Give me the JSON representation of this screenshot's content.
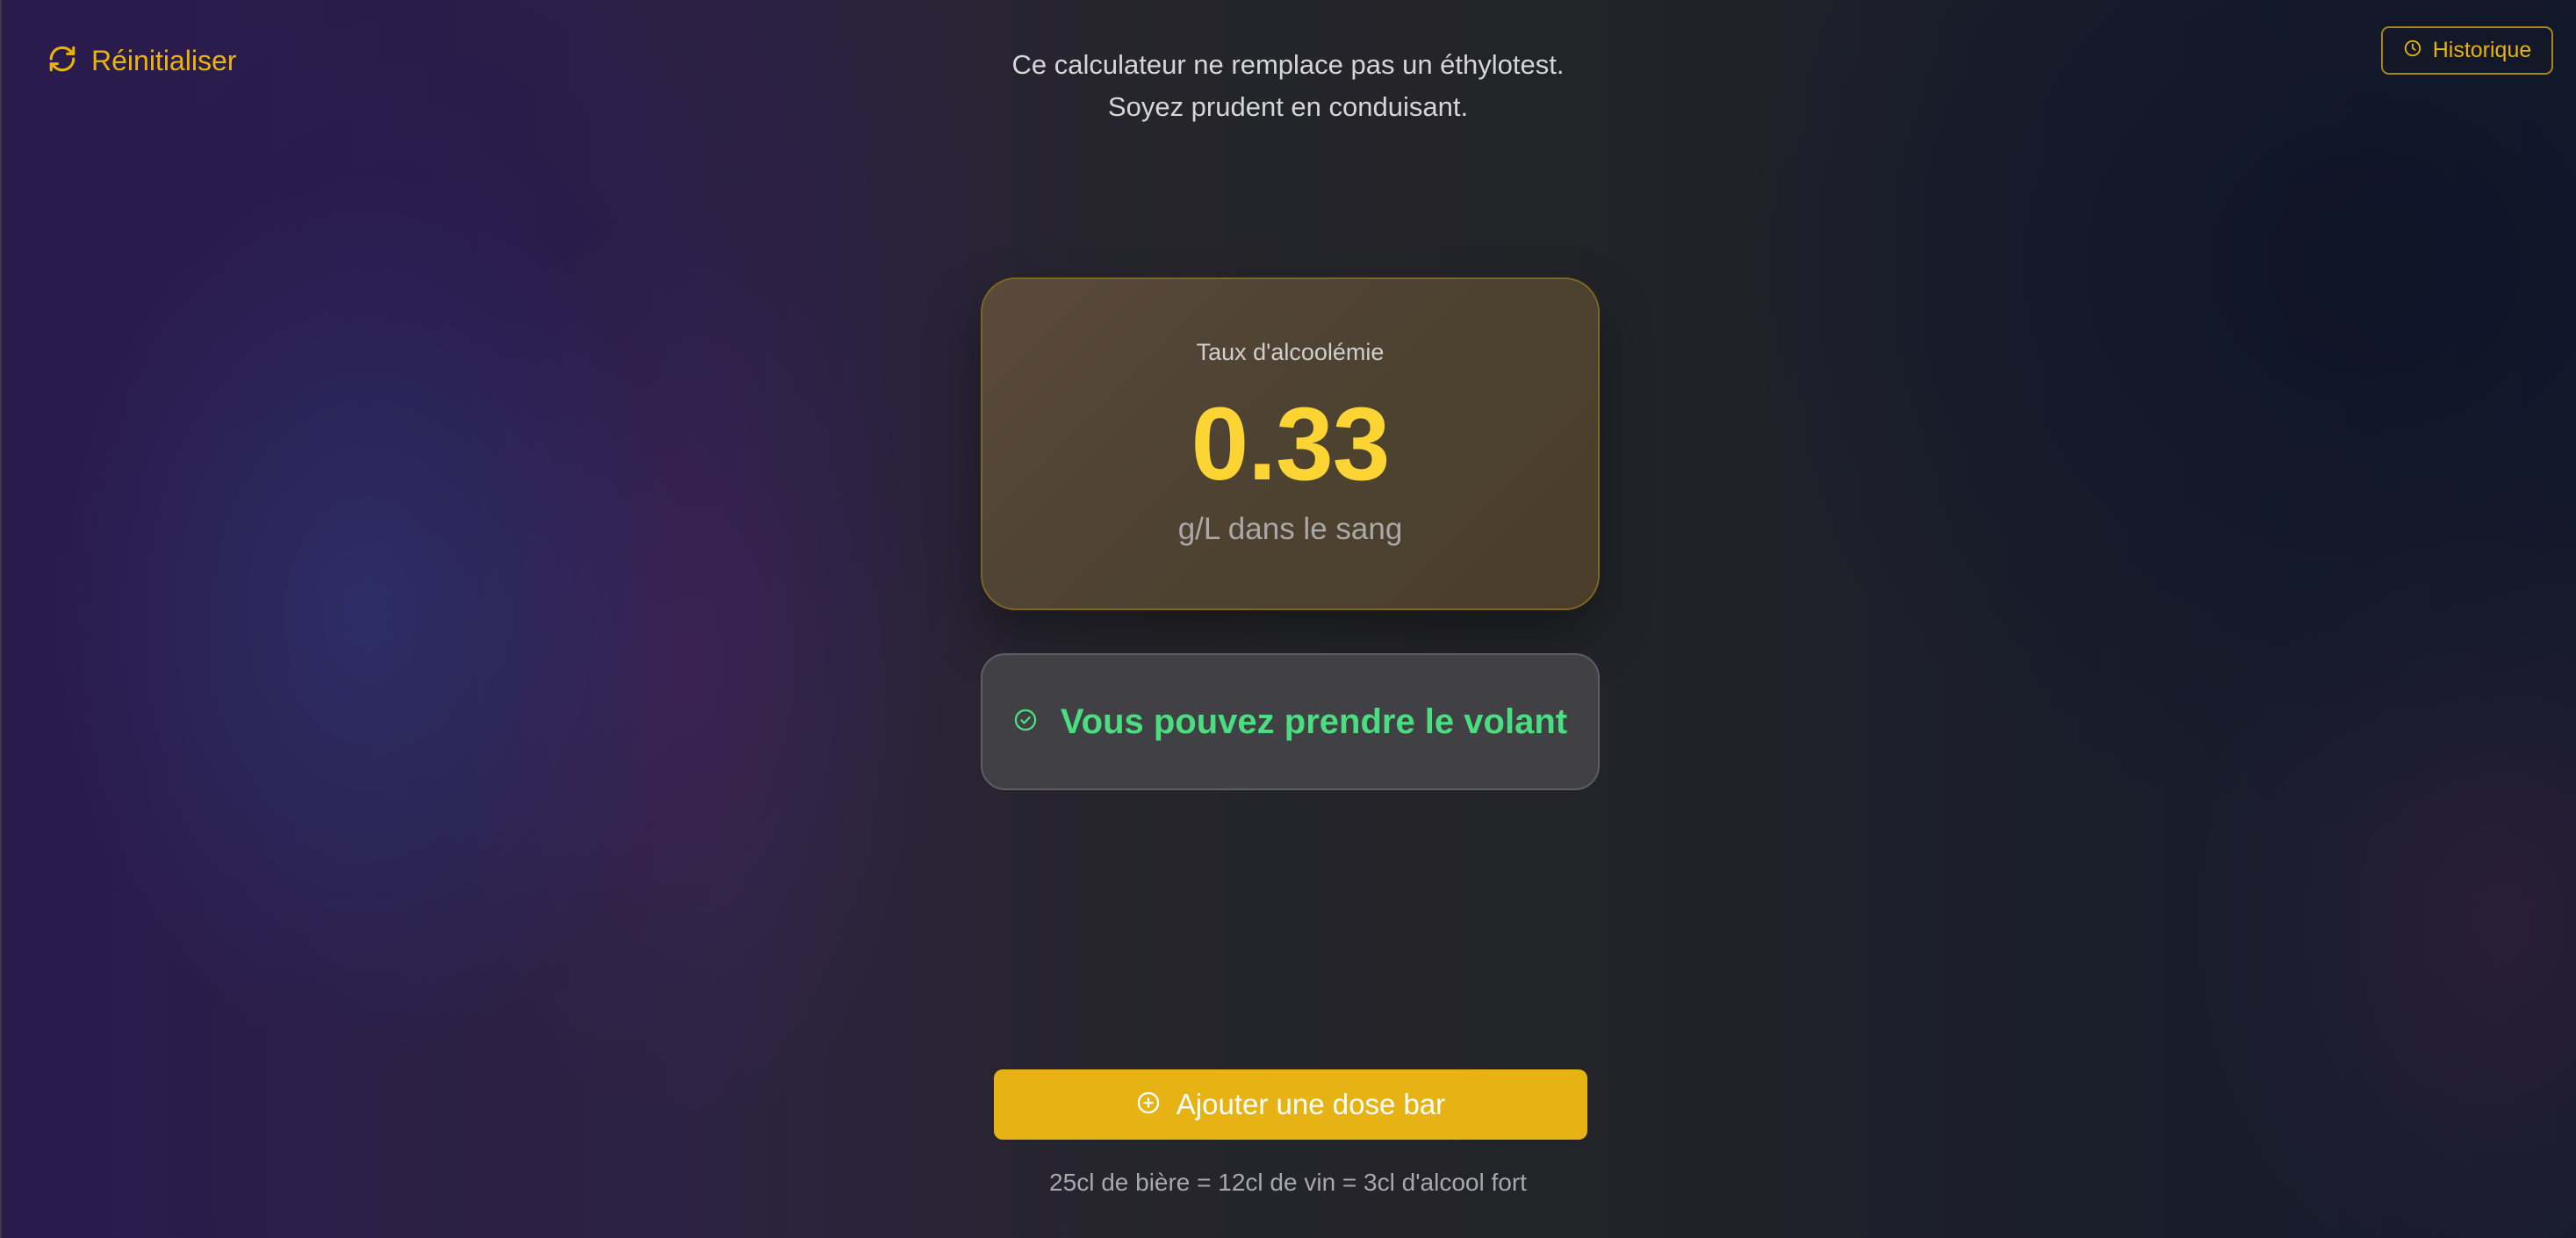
{
  "header": {
    "reset_label": "Réinitialiser",
    "reset_icon": "refresh-icon",
    "history_label": "Historique",
    "history_icon": "clock-icon",
    "disclaimer_line1": "Ce calculateur ne remplace pas un éthylotest.",
    "disclaimer_line2": "Soyez prudent en conduisant."
  },
  "result": {
    "title": "Taux d'alcoolémie",
    "value": "0.33",
    "unit": "g/L dans le sang"
  },
  "status": {
    "icon": "check-circle-icon",
    "label": "Vous pouvez prendre le volant",
    "color": "#4ade80"
  },
  "actions": {
    "add_label": "Ajouter une dose bar",
    "add_icon": "plus-circle-icon",
    "equivalence_note": "25cl de bière = 12cl de vin = 3cl d'alcool fort"
  },
  "colors": {
    "accent": "#eab308",
    "value": "#fcd535",
    "safe": "#4ade80",
    "button": "#e6b214"
  }
}
